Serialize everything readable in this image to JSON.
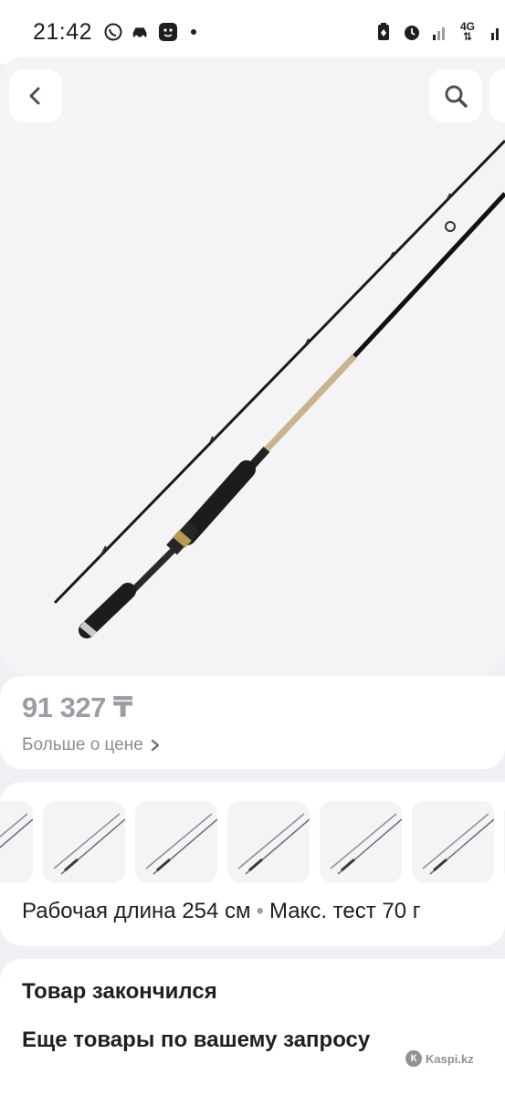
{
  "status_bar": {
    "time": "21:42",
    "network": "4G",
    "icons_left": [
      "whatsapp-icon",
      "car-icon",
      "smiley-icon"
    ],
    "icons_right": [
      "battery-saver-icon",
      "alarm-icon",
      "signal-icon",
      "network-icon"
    ]
  },
  "product": {
    "price": "91 327 ₸",
    "price_more": "Больше о цене",
    "specs": [
      "Рабочая длина 254 см",
      "Макс. тест 70 г"
    ],
    "spec_separator": "•",
    "variant_count": 7
  },
  "info": {
    "out_of_stock": "Товар закончился",
    "more_products": "Еще товары по вашему запросу"
  },
  "watermark": {
    "text": "Kaspi.kz",
    "logo_letter": "К"
  },
  "colors": {
    "background": "#eef0f3",
    "card": "#ffffff",
    "price": "#9a9ea4",
    "handle": "#1c1c1c",
    "blank": "#c8b38f"
  }
}
